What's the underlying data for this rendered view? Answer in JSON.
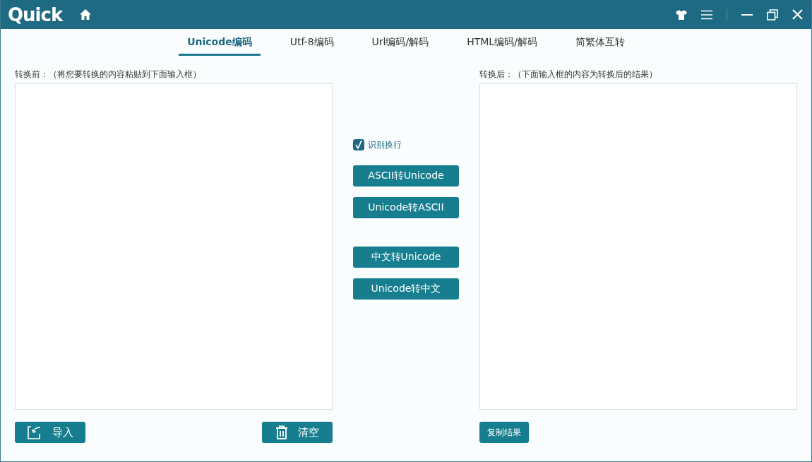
{
  "app": {
    "logo": "Quick"
  },
  "tabs": [
    {
      "label": "Unicode编码",
      "selected": true
    },
    {
      "label": "Utf-8编码",
      "selected": false
    },
    {
      "label": "Url编码/解码",
      "selected": false
    },
    {
      "label": "HTML编码/解码",
      "selected": false
    },
    {
      "label": "简繁体互转",
      "selected": false
    }
  ],
  "input_panel": {
    "label": "转换前：（将您要转换的内容粘贴到下面输入框）",
    "buttons": [
      {
        "kind": "import",
        "label": "导入"
      },
      {
        "kind": "clear",
        "label": "清空"
      }
    ]
  },
  "actions": {
    "line_break": {
      "label": "识别换行",
      "checked": true
    },
    "button_groups": [
      [
        "ASCII转Unicode",
        "Unicode转ASCII"
      ],
      [
        "中文转Unicode",
        "Unicode转中文"
      ]
    ]
  },
  "output_panel": {
    "label": "转换后：（下面输入框的内容为转换后的结果）",
    "button": "复制结果"
  }
}
